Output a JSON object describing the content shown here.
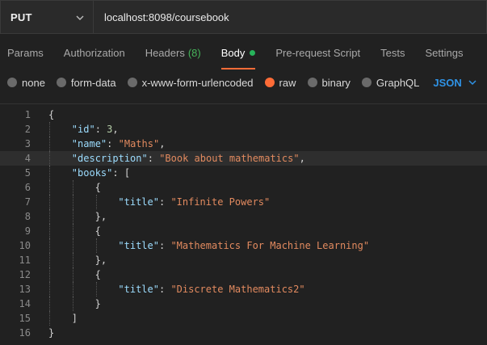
{
  "request": {
    "method": "PUT",
    "url": "localhost:8098/coursebook"
  },
  "tabs": [
    {
      "label": "Params"
    },
    {
      "label": "Authorization"
    },
    {
      "label": "Headers",
      "count": "(8)"
    },
    {
      "label": "Body",
      "active": true
    },
    {
      "label": "Pre-request Script"
    },
    {
      "label": "Tests"
    },
    {
      "label": "Settings"
    }
  ],
  "body_types": [
    {
      "label": "none"
    },
    {
      "label": "form-data"
    },
    {
      "label": "x-www-form-urlencoded"
    },
    {
      "label": "raw",
      "selected": true
    },
    {
      "label": "binary"
    },
    {
      "label": "GraphQL"
    }
  ],
  "language": "JSON",
  "lines": [
    {
      "n": "1",
      "text": "{"
    },
    {
      "n": "2",
      "text": "\"id\": 3,"
    },
    {
      "n": "3",
      "text": "\"name\": \"Maths\","
    },
    {
      "n": "4",
      "text": "\"description\": \"Book about mathematics\","
    },
    {
      "n": "5",
      "text": "\"books\": ["
    },
    {
      "n": "6",
      "text": "{"
    },
    {
      "n": "7",
      "text": "\"title\": \"Infinite Powers\""
    },
    {
      "n": "8",
      "text": "},"
    },
    {
      "n": "9",
      "text": "{"
    },
    {
      "n": "10",
      "text": "\"title\": \"Mathematics For Machine Learning\""
    },
    {
      "n": "11",
      "text": "},"
    },
    {
      "n": "12",
      "text": "{"
    },
    {
      "n": "13",
      "text": "\"title\": \"Discrete Mathematics2\""
    },
    {
      "n": "14",
      "text": "}"
    },
    {
      "n": "15",
      "text": "]"
    },
    {
      "n": "16",
      "text": "}"
    }
  ],
  "colors": {
    "accent": "#ff6c37",
    "key": "#9cdcfe",
    "string": "#e28a5f",
    "number": "#b5cea8",
    "count": "#46b35a",
    "language": "#2f93e6"
  },
  "icons": {
    "method_dropdown": "chevron-down-icon",
    "language_dropdown": "chevron-down-icon"
  }
}
